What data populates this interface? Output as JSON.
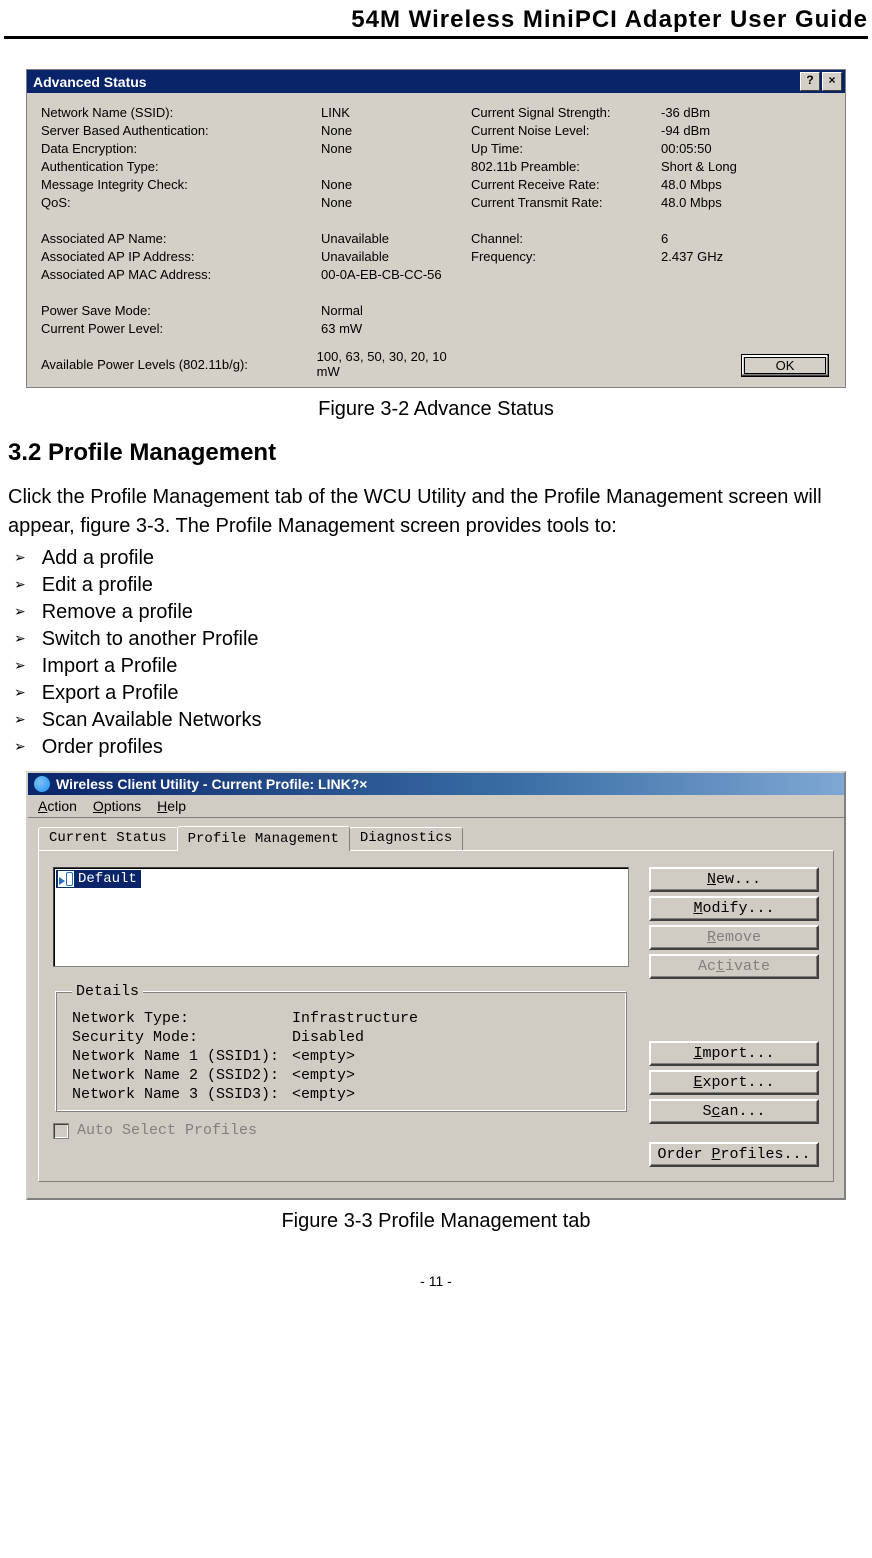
{
  "doc_title": "54M Wireless MiniPCI Adapter User Guide",
  "adv_status": {
    "title": "Advanced Status",
    "help_char": "?",
    "close_char": "×",
    "left": [
      {
        "label": "Network Name (SSID):",
        "value": "LINK"
      },
      {
        "label": "Server Based Authentication:",
        "value": "None"
      },
      {
        "label": "Data Encryption:",
        "value": "None"
      },
      {
        "label": "Authentication Type:",
        "value": ""
      },
      {
        "label": "Message Integrity Check:",
        "value": "None"
      },
      {
        "label": "QoS:",
        "value": "None"
      }
    ],
    "left2": [
      {
        "label": "Associated AP Name:",
        "value": "Unavailable"
      },
      {
        "label": "Associated AP IP Address:",
        "value": "Unavailable"
      },
      {
        "label": "Associated AP MAC Address:",
        "value": "00-0A-EB-CB-CC-56"
      }
    ],
    "left3": [
      {
        "label": "Power Save Mode:",
        "value": "Normal"
      },
      {
        "label": "Current Power Level:",
        "value": "63 mW"
      }
    ],
    "left4": [
      {
        "label": "Available Power Levels (802.11b/g):",
        "value": "100, 63, 50, 30, 20, 10 mW"
      }
    ],
    "right": [
      {
        "label": "Current Signal Strength:",
        "value": "-36 dBm"
      },
      {
        "label": "Current Noise Level:",
        "value": "-94 dBm"
      },
      {
        "label": "Up Time:",
        "value": "00:05:50"
      },
      {
        "label": "802.11b Preamble:",
        "value": "Short & Long"
      },
      {
        "label": "Current Receive Rate:",
        "value": "48.0 Mbps"
      },
      {
        "label": "Current Transmit Rate:",
        "value": "48.0 Mbps"
      }
    ],
    "right2": [
      {
        "label": "Channel:",
        "value": "6"
      },
      {
        "label": "Frequency:",
        "value": "2.437 GHz"
      }
    ],
    "ok": "OK"
  },
  "figure32": "Figure 3-2    Advance Status",
  "section_heading": "3.2 Profile Management",
  "intro": "Click the Profile Management tab of the WCU Utility and the Profile Management screen will appear, figure 3-3. The Profile Management screen provides tools to:",
  "bullets": [
    "Add a profile",
    "Edit a profile",
    "Remove a profile",
    "Switch to another Profile",
    "Import a Profile",
    "Export a Profile",
    "Scan Available Networks",
    "Order profiles"
  ],
  "wcu": {
    "title": "Wireless Client Utility - Current Profile: LINK",
    "help_char": "?",
    "close_char": "×",
    "menu_action": "Action",
    "menu_options": "Options",
    "menu_help": "Help",
    "tabs": {
      "current": "Current Status",
      "profile": "Profile Management",
      "diag": "Diagnostics"
    },
    "profile_item": "Default",
    "details_legend": "Details",
    "details": [
      {
        "label": "Network Type:",
        "value": "Infrastructure"
      },
      {
        "label": "Security Mode:",
        "value": "Disabled"
      },
      {
        "label": "Network Name 1 (SSID1):",
        "value": "<empty>"
      },
      {
        "label": "Network Name 2 (SSID2):",
        "value": "<empty>"
      },
      {
        "label": "Network Name 3 (SSID3):",
        "value": "<empty>"
      }
    ],
    "auto_select": "Auto Select Profiles",
    "buttons": {
      "new": "New...",
      "modify": "Modify...",
      "remove": "Remove",
      "activate": "Activate",
      "import": "Import...",
      "export": "Export...",
      "scan": "Scan...",
      "order": "Order Profiles..."
    }
  },
  "figure33": "Figure 3-3    Profile Management tab",
  "page_number": "- 11 -"
}
